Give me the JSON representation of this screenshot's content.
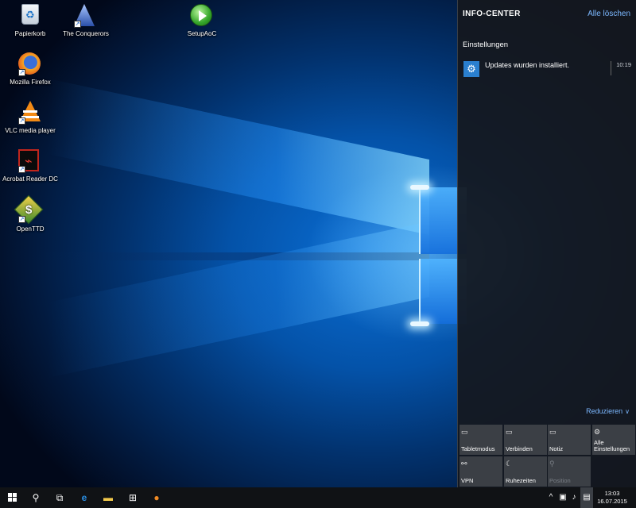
{
  "desktop": {
    "icons": [
      {
        "label": "Papierkorb",
        "icon": "recycle-bin-icon"
      },
      {
        "label": "The Conquerors",
        "icon": "conquerors-icon"
      },
      {
        "label": "SetupAoC",
        "icon": "play-icon"
      },
      {
        "label": "Mozilla Firefox",
        "icon": "firefox-icon"
      },
      {
        "label": "VLC media player",
        "icon": "vlc-icon"
      },
      {
        "label": "Acrobat Reader DC",
        "icon": "acrobat-icon"
      },
      {
        "label": "OpenTTD",
        "icon": "openttd-icon"
      }
    ]
  },
  "action_center": {
    "title": "INFO-CENTER",
    "clear_all": "Alle löschen",
    "group": "Einstellungen",
    "notification": {
      "text": "Updates wurden installiert.",
      "time": "10:19",
      "icon": "settings-gear-icon"
    },
    "collapse": "Reduzieren",
    "quick_actions": [
      {
        "label": "Tabletmodus",
        "icon": "tablet-mode-icon",
        "enabled": true
      },
      {
        "label": "Verbinden",
        "icon": "connect-icon",
        "enabled": true
      },
      {
        "label": "Notiz",
        "icon": "note-icon",
        "enabled": true
      },
      {
        "label": "Alle Einstellungen",
        "icon": "gear-icon",
        "enabled": true
      },
      {
        "label": "VPN",
        "icon": "vpn-icon",
        "enabled": true
      },
      {
        "label": "Ruhezeiten",
        "icon": "moon-icon",
        "enabled": true
      },
      {
        "label": "Position",
        "icon": "location-icon",
        "enabled": false
      }
    ]
  },
  "taskbar": {
    "items": [
      "start-icon",
      "search-icon",
      "task-view-icon",
      "edge-icon",
      "file-explorer-icon",
      "store-icon",
      "firefox-icon"
    ],
    "clock": {
      "time": "13:03",
      "date": "16.07.2015"
    }
  },
  "colors": {
    "accent": "#7cb8ff",
    "tile": "#3b3f45",
    "panel": "#14181e"
  }
}
